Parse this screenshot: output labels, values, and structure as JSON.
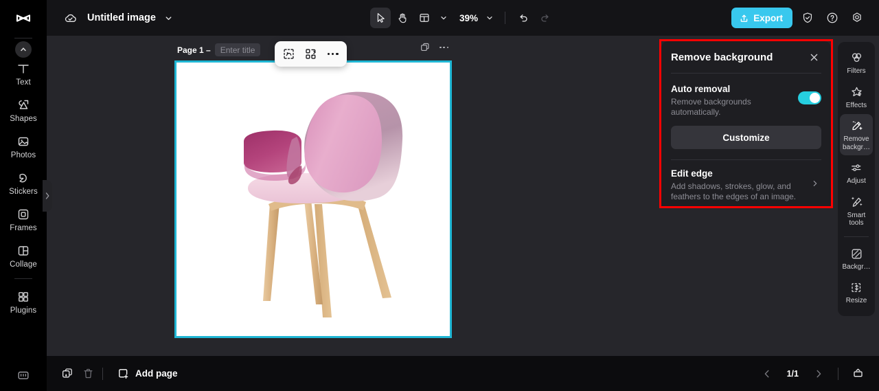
{
  "app": {
    "logo": "capcut-logo",
    "document_title": "Untitled image"
  },
  "left_sidebar": {
    "collapse_icon": "chevron-up-icon",
    "items": [
      {
        "label": "Text",
        "icon": "text-icon"
      },
      {
        "label": "Shapes",
        "icon": "shapes-icon"
      },
      {
        "label": "Photos",
        "icon": "photos-icon"
      },
      {
        "label": "Stickers",
        "icon": "stickers-icon"
      },
      {
        "label": "Frames",
        "icon": "frames-icon"
      },
      {
        "label": "Collage",
        "icon": "collage-icon"
      },
      {
        "label": "Plugins",
        "icon": "plugins-icon"
      }
    ],
    "bottom_icon": "keyboard-shortcuts-icon",
    "handle_icon": "chevron-right-icon"
  },
  "toolbar": {
    "cloud_icon": "cloud-saved-icon",
    "title_caret_icon": "chevron-down-icon",
    "select_tool": "cursor-select-icon",
    "hand_tool": "hand-pan-icon",
    "layout_tool": "layout-grid-icon",
    "layout_caret": "chevron-down-icon",
    "zoom_level": "39%",
    "zoom_caret": "chevron-down-icon",
    "undo_icon": "undo-icon",
    "redo_icon": "redo-icon",
    "export_label": "Export",
    "export_icon": "upload-icon",
    "export_color": "#38c8ee",
    "shield_icon": "shield-check-icon",
    "help_icon": "help-circle-icon",
    "settings_icon": "settings-gear-icon"
  },
  "canvas": {
    "page_label": "Page 1 –",
    "title_placeholder": "Enter title",
    "duplicate_icon": "duplicate-page-icon",
    "more_icon": "more-horizontal-icon",
    "selection_color": "#1fb6d4",
    "object_toolbar": {
      "cutout_icon": "cutout-select-icon",
      "replace_icon": "replace-image-icon",
      "more_icon": "more-horizontal-icon"
    },
    "artwork": {
      "description": "pink upholstered armchair with light wooden legs on white background",
      "shell_top_color": "#e6a8c8",
      "shell_side_color": "#b0899f",
      "arm_color": "#a5396f",
      "seat_color": "#f3d2e0",
      "leg_color": "#dcb988"
    }
  },
  "bottom_bar": {
    "duplicate_icon": "duplicate-page-icon",
    "delete_icon": "trash-icon",
    "add_page_icon": "add-page-icon",
    "add_page_label": "Add page",
    "prev_icon": "chevron-left-icon",
    "page_count": "1/1",
    "next_icon": "chevron-right-icon",
    "present_icon": "present-icon"
  },
  "right_rail": {
    "items": [
      {
        "label": "Filters",
        "icon": "filters-icon",
        "active": false
      },
      {
        "label": "Effects",
        "icon": "effects-icon",
        "active": false
      },
      {
        "label": "Remove backgr…",
        "icon": "remove-background-icon",
        "active": true
      },
      {
        "label": "Adjust",
        "icon": "adjust-sliders-icon",
        "active": false
      },
      {
        "label": "Smart tools",
        "icon": "smart-tools-icon",
        "active": false
      },
      {
        "label": "Backgr…",
        "icon": "background-icon",
        "active": false
      },
      {
        "label": "Resize",
        "icon": "resize-icon",
        "active": false
      }
    ]
  },
  "remove_background_panel": {
    "title": "Remove background",
    "close_icon": "close-icon",
    "highlight_color": "#ff0000",
    "auto_removal": {
      "heading": "Auto removal",
      "description": "Remove backgrounds automatically.",
      "toggle_on": true,
      "toggle_color": "#26cfe0",
      "customize_label": "Customize"
    },
    "edit_edge": {
      "heading": "Edit edge",
      "description": "Add shadows, strokes, glow, and feathers to the edges of an image.",
      "chevron_icon": "chevron-right-icon"
    }
  }
}
